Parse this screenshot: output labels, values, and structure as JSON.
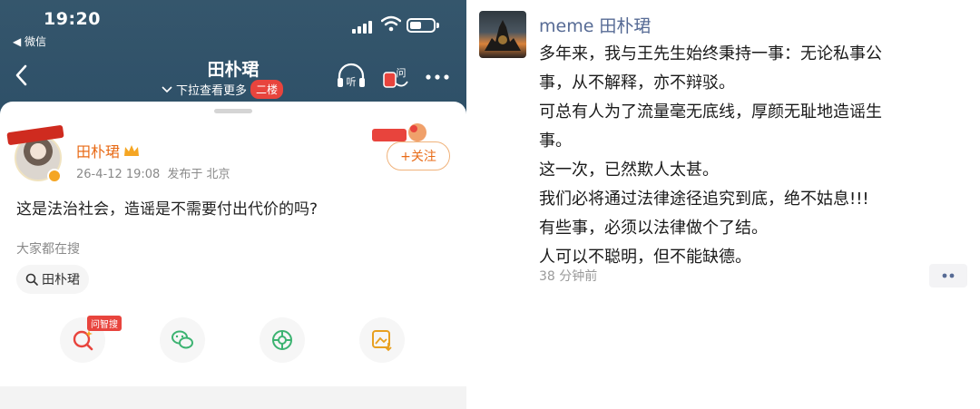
{
  "left": {
    "status": {
      "time": "19:20",
      "back_app": "◀ 微信"
    },
    "nav": {
      "title": "田朴珺",
      "subtitle": "下拉查看更多",
      "floor_badge": "二楼",
      "ask_label": "问"
    },
    "post": {
      "username": "田朴珺",
      "date": "26-4-12 19:08",
      "location": "发布于 北京",
      "follow_label": "+关注",
      "text": "这是法治社会，造谣是不需要付出代价的吗?",
      "search_hint": "大家都在搜",
      "search_chip": "田朴珺",
      "ai_tag": "问智搜"
    },
    "icons": [
      "listen-icon",
      "ask-icon",
      "more-icon",
      "search-icon",
      "wechat-icon",
      "moments-icon",
      "save-image-icon"
    ],
    "colors": {
      "topbar": "#2e5068",
      "accent": "#e86b17",
      "badge": "#e8443d"
    }
  },
  "right": {
    "name": "meme 田朴珺",
    "lines": [
      "多年来，我与王先生始终秉持一事：无论私事公",
      "事，从不解释，亦不辩驳。",
      "可总有人为了流量毫无底线，厚颜无耻地造谣生",
      "事。",
      "这一次，已然欺人太甚。",
      "我们必将通过法律途径追究到底，绝不姑息!!!",
      "有些事，必须以法律做个了结。",
      "人可以不聪明，但不能缺德。"
    ],
    "time": "38 分钟前",
    "colors": {
      "name": "#576b95"
    }
  }
}
